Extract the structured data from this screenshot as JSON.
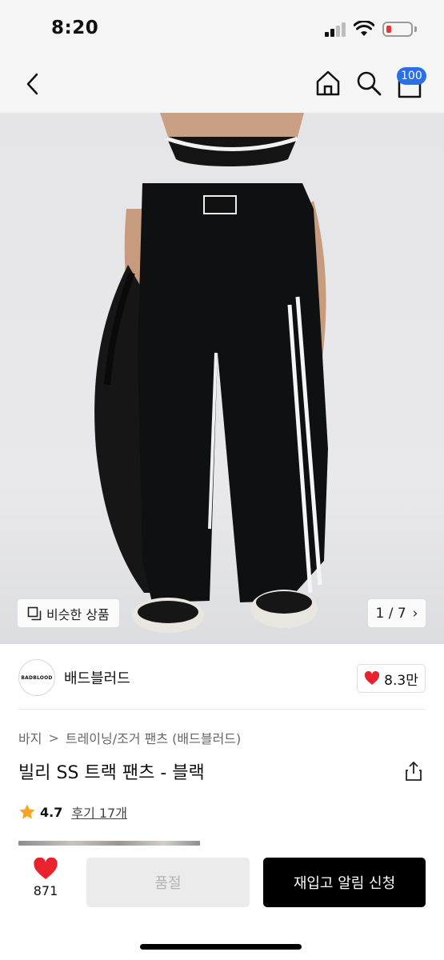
{
  "status_bar": {
    "time": "8:20",
    "battery_color": "#e53935"
  },
  "nav": {
    "icons": [
      "back-icon",
      "home-icon",
      "search-icon",
      "cart-icon"
    ],
    "cart_badge": "100",
    "badge_color": "#2a6fe8"
  },
  "product_image": {
    "similar_label": "비슷한 상품",
    "page_indicator": "1 / 7",
    "chevron": "›"
  },
  "brand": {
    "logo_text": "BADBLOOD",
    "name": "배드블러드",
    "like_count": "8.3만",
    "heart_color": "#e8232e"
  },
  "breadcrumb": {
    "items": [
      "바지",
      "트레이닝/조거 팬츠 (배드블러드)"
    ],
    "separator": ">"
  },
  "product": {
    "title": "빌리 SS 트랙 팬츠 - 블랙",
    "rating": "4.7",
    "review_link": "후기 17개",
    "star_color": "#f4a623"
  },
  "bottom_bar": {
    "wish_count": "871",
    "soldout_label": "품절",
    "restock_label": "재입고 알림 신청"
  }
}
